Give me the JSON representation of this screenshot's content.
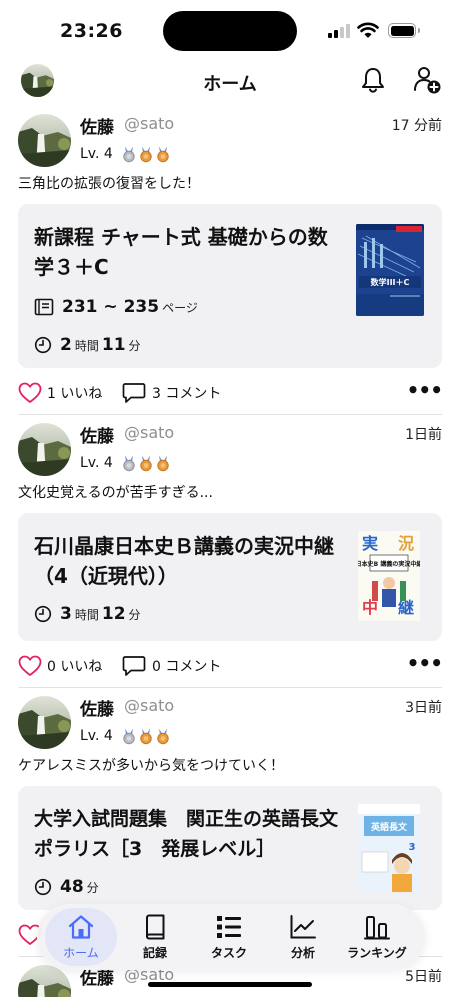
{
  "status": {
    "time": "23:26"
  },
  "header": {
    "title": "ホーム"
  },
  "posts": [
    {
      "name": "佐藤",
      "handle": "@sato",
      "ago": "17 分前",
      "level": "Lv. 4",
      "text": "三角比の拡張の復習をした！",
      "book": {
        "title": "新課程 チャート式 基礎からの数学３＋C",
        "pages_value": "231 ~ 235",
        "pages_unit": "ページ",
        "hours": "2",
        "hours_unit": "時間",
        "minutes": "11",
        "minutes_unit": "分",
        "cover_text": "数学III＋C"
      },
      "likes": "1 いいね",
      "comments": "3 コメント"
    },
    {
      "name": "佐藤",
      "handle": "@sato",
      "ago": "1日前",
      "level": "Lv. 4",
      "text": "文化史覚えるのが苦手すぎる...",
      "book": {
        "title": "石川晶康日本史Ｂ講義の実況中継（4（近現代））",
        "hours": "3",
        "hours_unit": "時間",
        "minutes": "12",
        "minutes_unit": "分",
        "cover_text": "日本史B 講義の実況中継"
      },
      "likes": "0 いいね",
      "comments": "0 コメント"
    },
    {
      "name": "佐藤",
      "handle": "@sato",
      "ago": "3日前",
      "level": "Lv. 4",
      "text": "ケアレスミスが多いから気をつけていく！",
      "book": {
        "title": "大学入試問題集　関正生の英語長文ポラリス［3　発展レベル］",
        "minutes": "48",
        "minutes_unit": "分",
        "cover_text": "英語長文"
      },
      "likes": "",
      "comments": ""
    },
    {
      "name": "佐藤",
      "handle": "@sato",
      "ago": "5日前"
    }
  ],
  "tabs": [
    {
      "label": "ホーム",
      "icon": "home-icon"
    },
    {
      "label": "記録",
      "icon": "book-icon"
    },
    {
      "label": "タスク",
      "icon": "list-icon"
    },
    {
      "label": "分析",
      "icon": "chart-icon"
    },
    {
      "label": "ランキング",
      "icon": "ranking-icon"
    }
  ],
  "colors": {
    "accent": "#4a6cf7",
    "card": "#f1f1f4",
    "like": "#e0245e"
  }
}
